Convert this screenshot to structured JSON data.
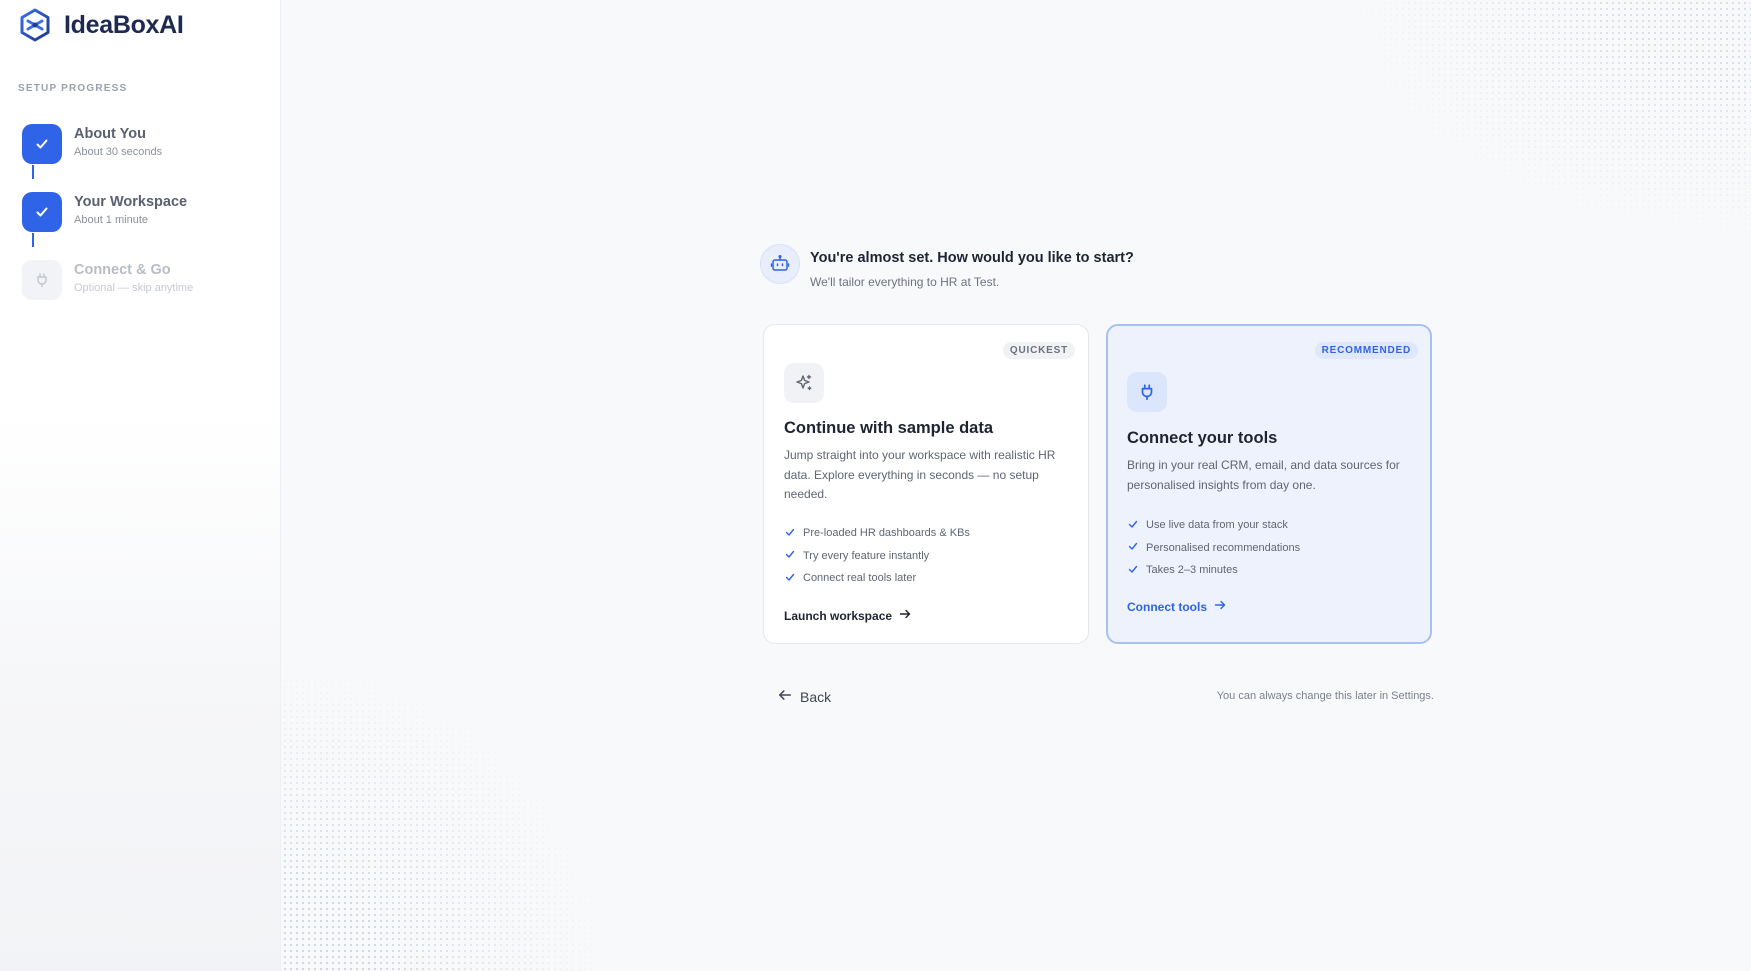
{
  "brand": {
    "name": "IdeaBoxAI",
    "logo_icon": "hexagon-logo-icon"
  },
  "sidebar": {
    "section_label": "SETUP PROGRESS",
    "steps": [
      {
        "title": "About You",
        "subtitle": "About 30 seconds",
        "status": "complete"
      },
      {
        "title": "Your Workspace",
        "subtitle": "About 1 minute",
        "status": "complete"
      },
      {
        "title": "Connect & Go",
        "subtitle": "Optional — skip anytime",
        "status": "pending"
      }
    ]
  },
  "intro": {
    "question": "You're almost set. How would you like to start?",
    "subtitle": "We'll tailor everything to HR at Test."
  },
  "cards": [
    {
      "tag": "QUICKEST",
      "icon": "sparkles-icon",
      "title": "Continue with sample data",
      "description": "Jump straight into your workspace with realistic HR data. Explore everything in seconds — no setup needed.",
      "features": [
        "Pre-loaded HR dashboards & KBs",
        "Try every feature instantly",
        "Connect real tools later"
      ],
      "cta": "Launch workspace"
    },
    {
      "tag": "RECOMMENDED",
      "icon": "plug-icon",
      "title": "Connect your tools",
      "description": "Bring in your real CRM, email, and data sources for personalised insights from day one.",
      "features": [
        "Use live data from your stack",
        "Personalised recommendations",
        "Takes 2–3 minutes"
      ],
      "cta": "Connect tools"
    }
  ],
  "footer": {
    "back_label": "Back",
    "note": "You can always change this later in Settings."
  },
  "colors": {
    "accent": "#2f64e8",
    "accent_soft": "#eef2fd",
    "text": "#1f2433"
  }
}
